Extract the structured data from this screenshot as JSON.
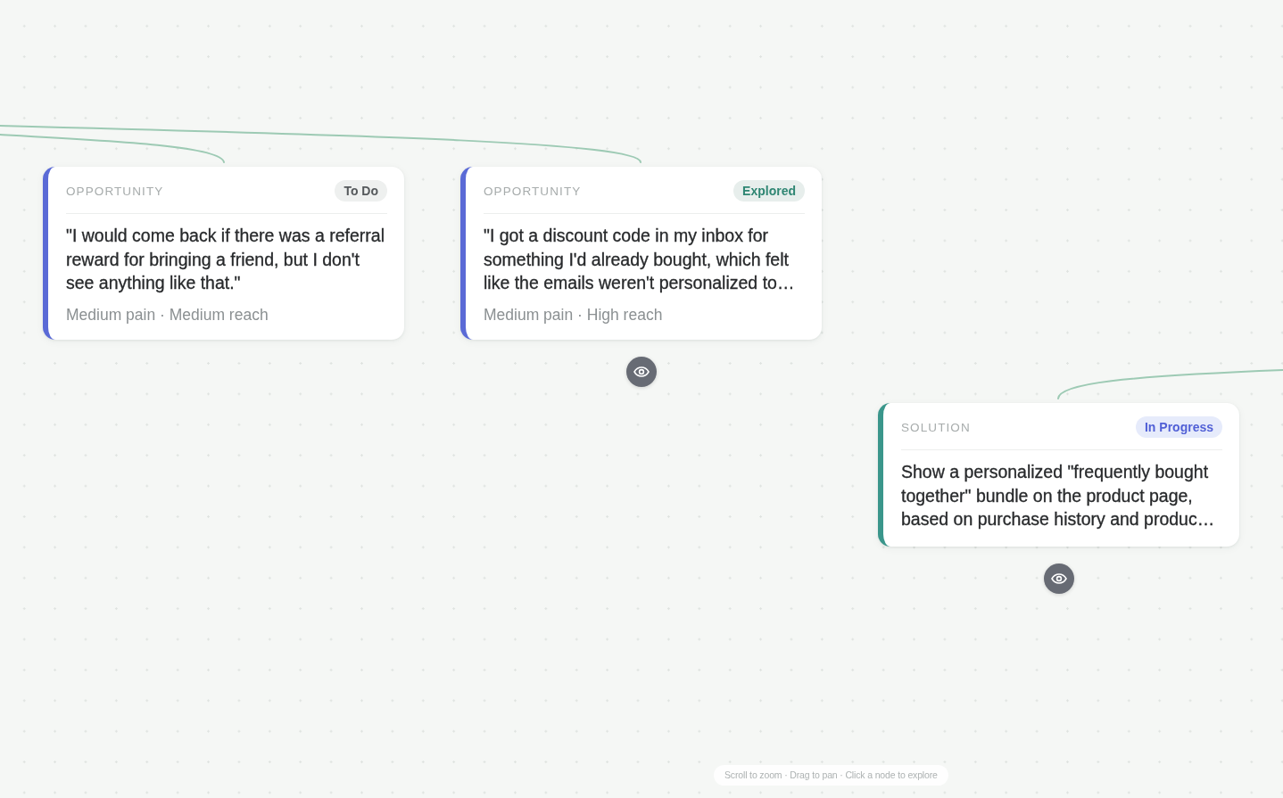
{
  "canvas": {
    "nodes": [
      {
        "kind": "opportunity",
        "type_label": "OPPORTUNITY",
        "status": {
          "label": "To Do",
          "kind": "todo"
        },
        "text": "\"I would come back if there was a referral reward for bringing a friend, but I don't see anything like that.\"",
        "meta": "Medium pain · Medium reach",
        "view_button": false
      },
      {
        "kind": "opportunity",
        "type_label": "OPPORTUNITY",
        "status": {
          "label": "Explored",
          "kind": "explored"
        },
        "text": "\"I got a discount code in my inbox for something I'd already bought, which felt like the emails weren't personalized to…",
        "meta": "Medium pain · High reach",
        "view_button": true
      },
      {
        "kind": "solution",
        "type_label": "SOLUTION",
        "status": {
          "label": "In Progress",
          "kind": "in_progress"
        },
        "text": "Show a personalized \"frequently bought together\" bundle on the product page, based on purchase history and produc…",
        "view_button": true
      }
    ]
  },
  "hint": "Scroll to zoom · Drag to pan · Click a node to explore"
}
